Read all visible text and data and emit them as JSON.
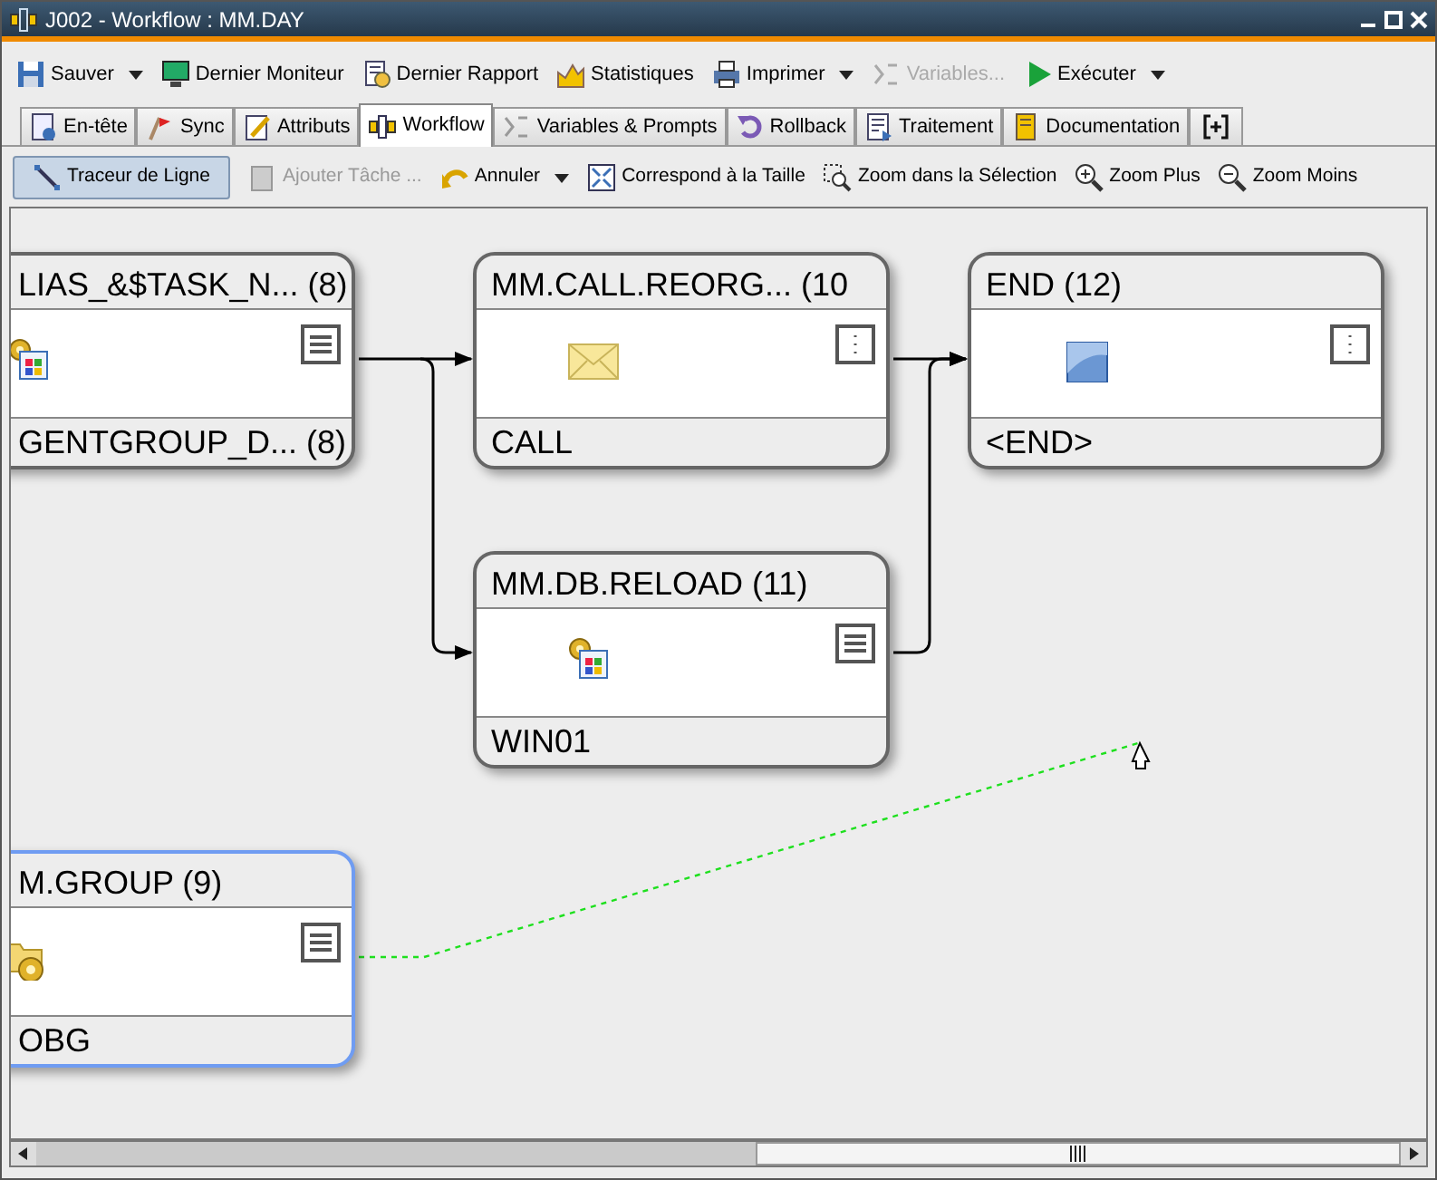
{
  "window": {
    "title": "J002 - Workflow : MM.DAY"
  },
  "toolbar": [
    {
      "label": "Sauver",
      "dropdown": true,
      "disabled": false
    },
    {
      "label": "Dernier Moniteur",
      "dropdown": false,
      "disabled": false
    },
    {
      "label": "Dernier Rapport",
      "dropdown": false,
      "disabled": false
    },
    {
      "label": "Statistiques",
      "dropdown": false,
      "disabled": false
    },
    {
      "label": "Imprimer",
      "dropdown": true,
      "disabled": false
    },
    {
      "label": "Variables...",
      "dropdown": false,
      "disabled": true
    },
    {
      "label": "Exécuter",
      "dropdown": true,
      "disabled": false
    }
  ],
  "tabs": [
    {
      "label": "En-tête",
      "selected": false
    },
    {
      "label": "Sync",
      "selected": false
    },
    {
      "label": "Attributs",
      "selected": false
    },
    {
      "label": "Workflow",
      "selected": true
    },
    {
      "label": "Variables & Prompts",
      "selected": false
    },
    {
      "label": "Rollback",
      "selected": false
    },
    {
      "label": "Traitement",
      "selected": false
    },
    {
      "label": "Documentation",
      "selected": false
    }
  ],
  "canvas_toolbar": [
    {
      "label": "Traceur de Ligne",
      "selected": true,
      "disabled": false,
      "dropdown": false
    },
    {
      "label": "Ajouter Tâche ...",
      "selected": false,
      "disabled": true,
      "dropdown": false
    },
    {
      "label": "Annuler",
      "selected": false,
      "disabled": false,
      "dropdown": true
    },
    {
      "label": "Correspond à la Taille",
      "selected": false,
      "disabled": false,
      "dropdown": false
    },
    {
      "label": "Zoom dans la Sélection",
      "selected": false,
      "disabled": false,
      "dropdown": false
    },
    {
      "label": "Zoom Plus",
      "selected": false,
      "disabled": false,
      "dropdown": false
    },
    {
      "label": "Zoom Moins",
      "selected": false,
      "disabled": false,
      "dropdown": false
    }
  ],
  "workflow": {
    "nodes": [
      {
        "title": "LIAS_&$TASK_N... (8)",
        "footer": "GENTGROUP_D... (8)",
        "kind": "windows",
        "selected": false
      },
      {
        "title": "MM.CALL.REORG... (10",
        "footer": "CALL",
        "kind": "mail",
        "selected": false
      },
      {
        "title": "END (12)",
        "footer": "<END>",
        "kind": "end",
        "selected": false
      },
      {
        "title": "MM.DB.RELOAD (11)",
        "footer": "WIN01",
        "kind": "windows",
        "selected": false
      },
      {
        "title": "M.GROUP (9)",
        "footer": "OBG",
        "kind": "group",
        "selected": true
      }
    ]
  }
}
